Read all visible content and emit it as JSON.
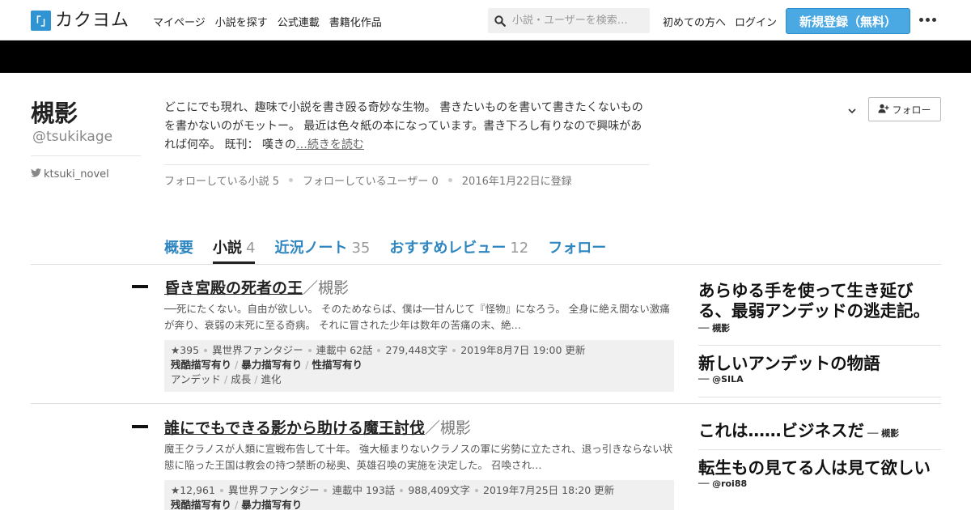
{
  "header": {
    "logo_mark": "「」",
    "logo_text": "カクヨム",
    "nav": [
      "マイページ",
      "小説を探す",
      "公式連載",
      "書籍化作品"
    ],
    "search_placeholder": "小説・ユーザーを検索…",
    "first_time": "初めての方へ",
    "login": "ログイン",
    "signup": "新規登録（無料）"
  },
  "profile": {
    "name": "槻影",
    "handle": "@tsukikage",
    "twitter": "ktsuki_novel",
    "bio": "どこにでも現れ、趣味で小説を書き殴る奇妙な生物。 書きたいものを書いて書きたくないものを書かないのがモットー。 最近は色々紙の本になっています。書き下ろし有りなので興味があれば何卒。 既刊： 嘆きの",
    "read_more": "…続きを読む",
    "stats": [
      "フォローしている小説 5",
      "フォローしているユーザー 0",
      "2016年1月22日に登録"
    ],
    "follow_button": "フォロー"
  },
  "tabs": [
    {
      "label": "概要",
      "count": ""
    },
    {
      "label": "小説",
      "count": "4"
    },
    {
      "label": "近況ノート",
      "count": "35"
    },
    {
      "label": "おすすめレビュー",
      "count": "12"
    },
    {
      "label": "フォロー",
      "count": ""
    }
  ],
  "works": [
    {
      "title": "昏き宮殿の死者の王",
      "author": "／槻影",
      "desc": "──死にたくない。自由が欲しい。 そのためならば、僕は──甘んじて『怪物』になろう。 全身に絶え間ない激痛が奔り、衰弱の末死に至る奇病。 それに冒された少年は数年の苦痛の末、絶…",
      "stars": "★395",
      "genre": "異世界ファンタジー",
      "status": "連載中 62話",
      "chars": "279,448文字",
      "updated": "2019年8月7日 19:00 更新",
      "warnings": [
        "残酷描写有り",
        "暴力描写有り",
        "性描写有り"
      ],
      "tags": [
        "アンデッド",
        "成長",
        "進化"
      ]
    },
    {
      "title": "誰にでもできる影から助ける魔王討伐",
      "author": "／槻影",
      "desc": "魔王クラノスが人類に宣戦布告して十年。 強大極まりないクラノスの軍に劣勢に立たされ、退っ引きならない状態に陥った王国は教会の持つ禁断の秘奥、英雄召喚の実施を決定した。 召喚され…",
      "stars": "★12,961",
      "genre": "異世界ファンタジー",
      "status": "連載中 193話",
      "chars": "988,409文字",
      "updated": "2019年7月25日 18:20 更新",
      "warnings": [
        "残酷描写有り",
        "暴力描写有り"
      ],
      "tags": []
    }
  ],
  "reviews": [
    {
      "title": "あらゆる手を使って生き延びる、最弱アンデッドの逃走記。",
      "author": "── 槻影"
    },
    {
      "title": "新しいアンデットの物語",
      "author": "── @SILA"
    },
    {
      "title": "これは……ビジネスだ",
      "author": "── 槻影"
    },
    {
      "title": "転生もの見てる人は見て欲しい",
      "author": "── @roi88"
    }
  ]
}
